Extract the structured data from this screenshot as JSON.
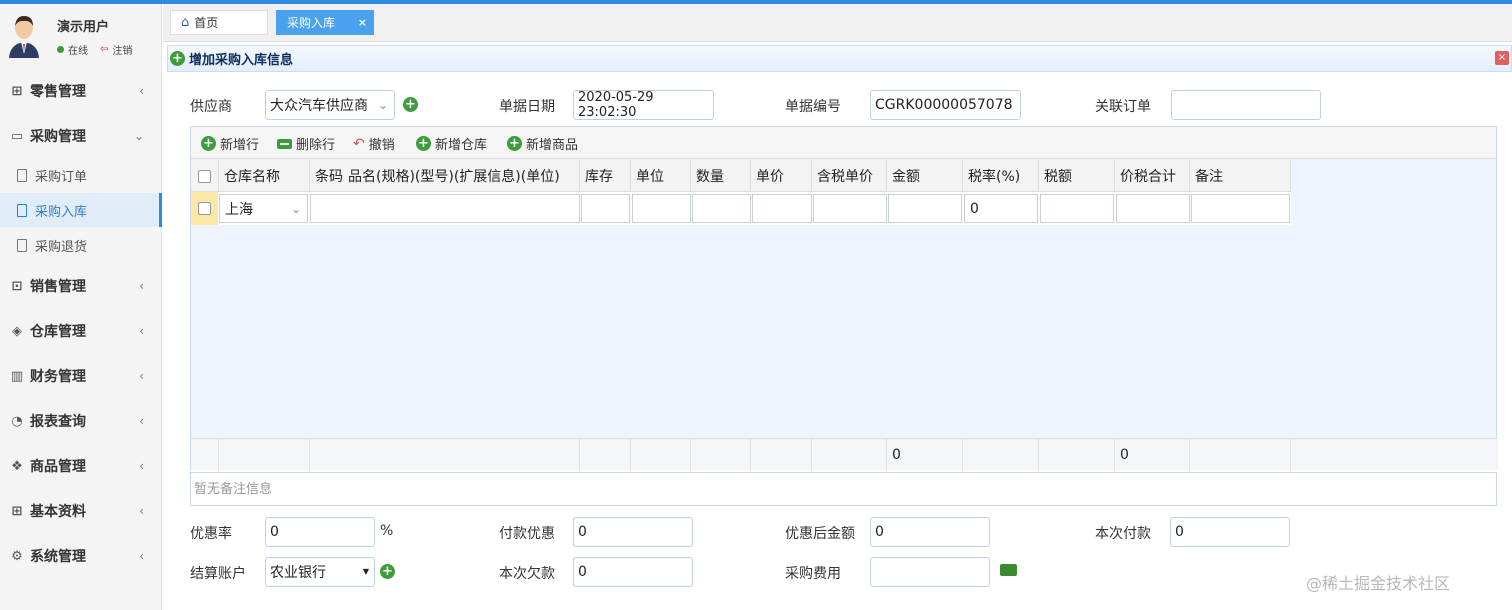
{
  "user": {
    "name": "演示用户",
    "status": "在线",
    "logout": "注销"
  },
  "sidebar": {
    "items": [
      {
        "label": "零售管理",
        "icon": "gift-icon"
      },
      {
        "label": "采购管理",
        "icon": "monitor-icon",
        "expanded": true,
        "children": [
          {
            "label": "采购订单"
          },
          {
            "label": "采购入库",
            "active": true
          },
          {
            "label": "采购退货"
          }
        ]
      },
      {
        "label": "销售管理",
        "icon": "briefcase-icon"
      },
      {
        "label": "仓库管理",
        "icon": "layers-icon"
      },
      {
        "label": "财务管理",
        "icon": "map-icon"
      },
      {
        "label": "报表查询",
        "icon": "pie-chart-icon"
      },
      {
        "label": "商品管理",
        "icon": "cubes-icon"
      },
      {
        "label": "基本资料",
        "icon": "grid-icon"
      },
      {
        "label": "系统管理",
        "icon": "gear-icon"
      }
    ]
  },
  "tabs": {
    "home": "首页",
    "active": "采购入库",
    "close": "×"
  },
  "panel": {
    "title": "增加采购入库信息"
  },
  "form": {
    "supplier_label": "供应商",
    "supplier_value": "大众汽车供应商",
    "date_label": "单据日期",
    "date_value": "2020-05-29 23:02:30",
    "number_label": "单据编号",
    "number_value": "CGRK00000057078",
    "related_label": "关联订单",
    "related_value": ""
  },
  "toolbar": {
    "add_row": "新增行",
    "delete_row": "删除行",
    "undo": "撤销",
    "add_warehouse": "新增仓库",
    "add_goods": "新增商品"
  },
  "table": {
    "columns": [
      "仓库名称",
      "条码",
      "品名(规格)(型号)(扩展信息)(单位)",
      "库存",
      "单位",
      "数量",
      "单价",
      "含税单价",
      "金额",
      "税率(%)",
      "税额",
      "价税合计",
      "备注"
    ],
    "row": {
      "warehouse": "上海",
      "tax_rate": "0"
    },
    "footer": {
      "amount_total": "0",
      "tax_total": "0"
    }
  },
  "remark_placeholder": "暂无备注信息",
  "bottom": {
    "discount_rate_label": "优惠率",
    "discount_rate_value": "0",
    "percent": "%",
    "payment_discount_label": "付款优惠",
    "payment_discount_value": "0",
    "after_discount_label": "优惠后金额",
    "after_discount_value": "0",
    "this_payment_label": "本次付款",
    "this_payment_value": "0",
    "account_label": "结算账户",
    "account_value": "农业银行",
    "this_debt_label": "本次欠款",
    "this_debt_value": "0",
    "purchase_fee_label": "采购费用",
    "purchase_fee_value": ""
  },
  "watermark": "@稀土掘金技术社区",
  "colors": {
    "accent": "#2f8bdf",
    "tab_active": "#4aa1ee",
    "add_green": "#3d9d3d"
  }
}
